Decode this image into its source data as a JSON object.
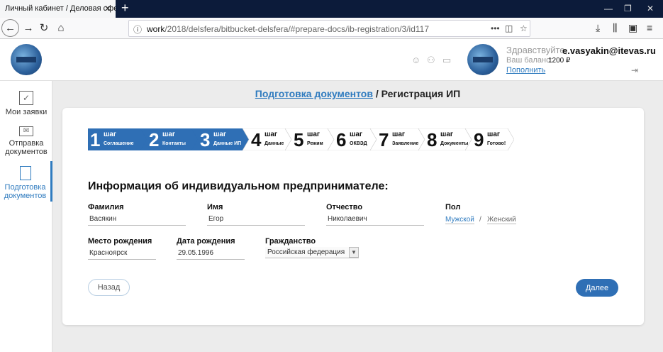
{
  "browser": {
    "tab_title": "Личный кабинет / Деловая сфера",
    "url_host": "work",
    "url_path": "/2018/delsfera/bitbucket-delsfera/#prepare-docs/ib-registration/3/id117"
  },
  "header": {
    "greeting": "Здравствуйте,",
    "email": "e.vasyakin@itevas.ru",
    "balance_label": "Ваш баланс:",
    "balance_value": "1200 ₽",
    "topup_label": "Пополнить"
  },
  "sidebar": {
    "items": [
      {
        "label": "Мои заявки"
      },
      {
        "label": "Отправка документов"
      },
      {
        "label": "Подготовка документов"
      }
    ]
  },
  "breadcrumb": {
    "link": "Подготовка документов",
    "separator": "/",
    "current": "Регистрация ИП"
  },
  "steps": [
    {
      "num": "1",
      "word": "шаг",
      "name": "Соглашение",
      "state": "done"
    },
    {
      "num": "2",
      "word": "шаг",
      "name": "Контакты",
      "state": "done"
    },
    {
      "num": "3",
      "word": "шаг",
      "name": "Данные ИП",
      "state": "done"
    },
    {
      "num": "4",
      "word": "шаг",
      "name": "Данные",
      "state": "todo"
    },
    {
      "num": "5",
      "word": "шаг",
      "name": "Режим",
      "state": "todo"
    },
    {
      "num": "6",
      "word": "шаг",
      "name": "ОКВЭД",
      "state": "todo"
    },
    {
      "num": "7",
      "word": "шаг",
      "name": "Заявление",
      "state": "todo"
    },
    {
      "num": "8",
      "word": "шаг",
      "name": "Документы",
      "state": "todo"
    },
    {
      "num": "9",
      "word": "шаг",
      "name": "Готово!",
      "state": "todo"
    }
  ],
  "form": {
    "title": "Информация об индивидуальном предпринимателе:",
    "surname_label": "Фамилия",
    "surname_value": "Васякин",
    "name_label": "Имя",
    "name_value": "Егор",
    "patronymic_label": "Отчество",
    "patronymic_value": "Николаевич",
    "gender_label": "Пол",
    "gender_male": "Мужской",
    "gender_sep": "/",
    "gender_female": "Женский",
    "birthplace_label": "Место рождения",
    "birthplace_value": "Красноярск",
    "birthdate_label": "Дата рождения",
    "birthdate_value": "29.05.1996",
    "citizenship_label": "Гражданство",
    "citizenship_value": "Российская федерация",
    "back_label": "Назад",
    "next_label": "Далее"
  },
  "colors": {
    "accent": "#2f6fb5",
    "step_done": "#2f6fb5",
    "link": "#2f7bbf"
  }
}
